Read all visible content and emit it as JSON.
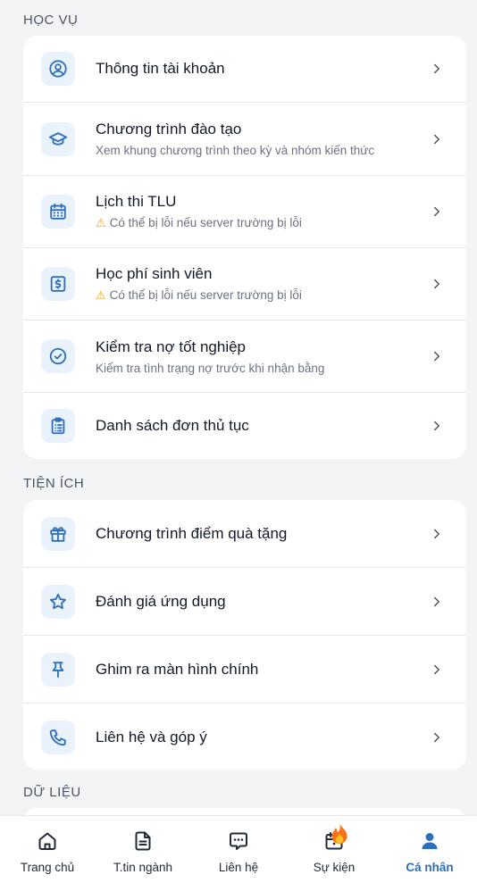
{
  "theme": {
    "accent": "#2d6fba",
    "icon_bg": "#eaf2fc",
    "warning": "#f59e0b"
  },
  "sections": {
    "hoc_vu": {
      "title": "HỌC VỤ",
      "items": [
        {
          "label": "Thông tin tài khoản",
          "sub": "",
          "icon": "user-circle-icon"
        },
        {
          "label": "Chương trình đào tạo",
          "sub": "Xem khung chương trình theo kỳ và nhóm kiến thức",
          "icon": "graduation-cap-icon"
        },
        {
          "label": "Lịch thi TLU",
          "sub": "Có thể bị lỗi nếu server trường bị lỗi",
          "icon": "calendar-icon",
          "warning": true
        },
        {
          "label": "Học phí sinh viên",
          "sub": "Có thể bị lỗi nếu server trường bị lỗi",
          "icon": "dollar-icon",
          "warning": true
        },
        {
          "label": "Kiểm tra nợ tốt nghiệp",
          "sub": "Kiểm tra tình trạng nợ trước khi nhận bằng",
          "icon": "check-circle-icon"
        },
        {
          "label": "Danh sách đơn thủ tục",
          "sub": "",
          "icon": "clipboard-icon"
        }
      ]
    },
    "tien_ich": {
      "title": "TIỆN ÍCH",
      "items": [
        {
          "label": "Chương trình điểm quà tặng",
          "icon": "gift-icon"
        },
        {
          "label": "Đánh giá ứng dụng",
          "icon": "star-icon"
        },
        {
          "label": "Ghim ra màn hình chính",
          "icon": "pin-icon"
        },
        {
          "label": "Liên hệ và góp ý",
          "icon": "phone-icon"
        }
      ]
    },
    "du_lieu": {
      "title": "DỮ LIỆU"
    }
  },
  "bottom_nav": [
    {
      "label": "Trang chủ",
      "icon": "home-icon"
    },
    {
      "label": "T.tin ngành",
      "icon": "document-icon"
    },
    {
      "label": "Liên hệ",
      "icon": "chat-icon"
    },
    {
      "label": "Sự kiện",
      "icon": "event-calendar-icon"
    },
    {
      "label": "Cá nhân",
      "icon": "user-icon",
      "active": true
    }
  ]
}
